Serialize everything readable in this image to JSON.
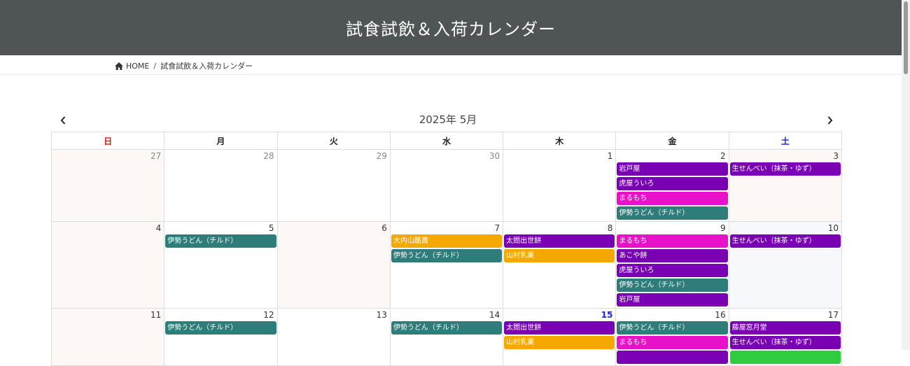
{
  "header": {
    "title": "試食試飲＆入荷カレンダー"
  },
  "breadcrumb": {
    "home": "HOME",
    "separator": "/",
    "current": "試食試飲＆入荷カレンダー"
  },
  "calendar": {
    "title": "2025年 5月",
    "prev": "‹",
    "next": "›",
    "weekdays": [
      "日",
      "月",
      "火",
      "水",
      "木",
      "金",
      "土"
    ],
    "colors": {
      "purple": "#7a00b3",
      "magenta": "#e810c8",
      "teal": "#2e7d7a",
      "orange": "#f5a800",
      "green": "#2ecc40"
    },
    "weeks": [
      {
        "days": [
          {
            "num": "27",
            "other": true,
            "events": []
          },
          {
            "num": "28",
            "other": true,
            "events": []
          },
          {
            "num": "29",
            "other": true,
            "events": []
          },
          {
            "num": "30",
            "other": true,
            "events": []
          },
          {
            "num": "1",
            "events": []
          },
          {
            "num": "2",
            "events": [
              {
                "label": "岩戸屋",
                "color": "purple"
              },
              {
                "label": "虎屋ういろ",
                "color": "purple"
              },
              {
                "label": "まるもち",
                "color": "magenta"
              },
              {
                "label": "伊勢うどん（チルド）",
                "color": "teal"
              }
            ]
          },
          {
            "num": "3",
            "events": [
              {
                "label": "生せんべい（抹茶・ゆず）",
                "color": "purple"
              }
            ]
          }
        ]
      },
      {
        "days": [
          {
            "num": "4",
            "events": []
          },
          {
            "num": "5",
            "events": [
              {
                "label": "伊勢うどん（チルド）",
                "color": "teal"
              }
            ]
          },
          {
            "num": "6",
            "events": []
          },
          {
            "num": "7",
            "events": [
              {
                "label": "大内山酪農",
                "color": "orange"
              },
              {
                "label": "伊勢うどん（チルド）",
                "color": "teal"
              }
            ]
          },
          {
            "num": "8",
            "events": [
              {
                "label": "太閤出世餅",
                "color": "purple"
              },
              {
                "label": "山村乳業",
                "color": "orange"
              }
            ]
          },
          {
            "num": "9",
            "events": [
              {
                "label": "まるもち",
                "color": "magenta"
              },
              {
                "label": "あこや餅",
                "color": "purple"
              },
              {
                "label": "虎屋ういろ",
                "color": "purple"
              },
              {
                "label": "伊勢うどん（チルド）",
                "color": "teal"
              },
              {
                "label": "岩戸屋",
                "color": "purple"
              }
            ]
          },
          {
            "num": "10",
            "events": [
              {
                "label": "生せんべい（抹茶・ゆず）",
                "color": "purple"
              }
            ]
          }
        ]
      },
      {
        "days": [
          {
            "num": "11",
            "events": []
          },
          {
            "num": "12",
            "events": [
              {
                "label": "伊勢うどん（チルド）",
                "color": "teal"
              }
            ]
          },
          {
            "num": "13",
            "events": []
          },
          {
            "num": "14",
            "events": [
              {
                "label": "伊勢うどん（チルド）",
                "color": "teal"
              }
            ]
          },
          {
            "num": "15",
            "today": true,
            "events": [
              {
                "label": "太閤出世餅",
                "color": "purple"
              },
              {
                "label": "山村乳業",
                "color": "orange"
              }
            ]
          },
          {
            "num": "16",
            "events": [
              {
                "label": "伊勢うどん（チルド）",
                "color": "teal"
              },
              {
                "label": "まるもち",
                "color": "magenta"
              },
              {
                "label": "",
                "color": "purple"
              }
            ]
          },
          {
            "num": "17",
            "events": [
              {
                "label": "藤屋窓月堂",
                "color": "purple"
              },
              {
                "label": "生せんべい（抹茶・ゆず）",
                "color": "purple"
              },
              {
                "label": "",
                "color": "green"
              }
            ]
          }
        ]
      }
    ]
  }
}
